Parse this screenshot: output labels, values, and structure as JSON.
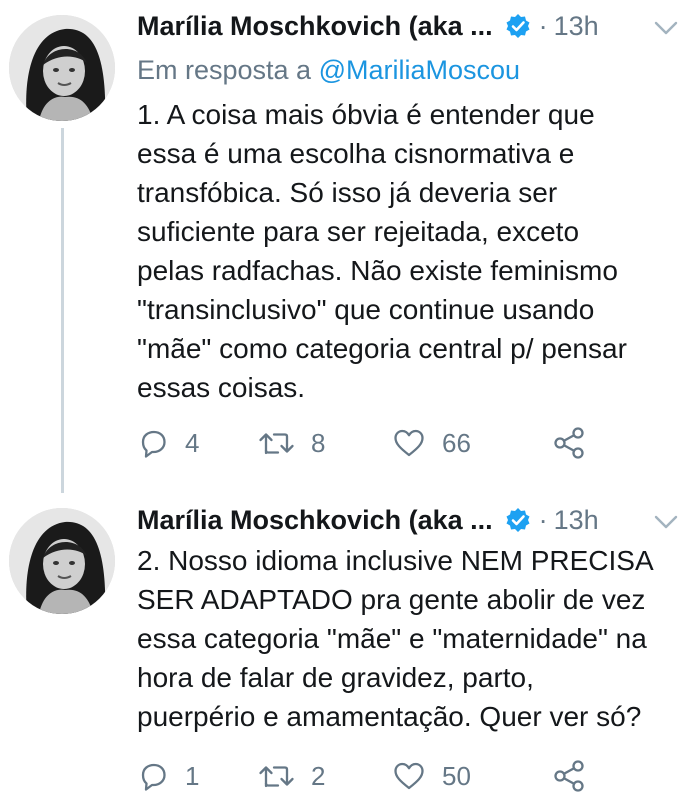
{
  "tweets": [
    {
      "author": "Marília Moschkovich (aka ...",
      "separator": "·",
      "time": "13h",
      "reply_prefix": "Em resposta a ",
      "reply_to": "@MariliaMoscou",
      "text": "1. A coisa mais óbvia é entender que\nessa é uma escolha cisnormativa e\ntransfóbica. Só isso já deveria ser\nsuficiente para ser rejeitada, exceto\npelas radfachas. Não existe feminismo\n\"transinclusivo\" que continue usando\n\"mãe\" como categoria central p/ pensar\nessas coisas.",
      "replies": "4",
      "retweets": "8",
      "likes": "66",
      "icons": {
        "verified": "verified-badge-icon",
        "caret": "chevron-down-icon",
        "reply": "reply-icon",
        "retweet": "retweet-icon",
        "like": "heart-icon",
        "share": "share-icon"
      }
    },
    {
      "author": "Marília Moschkovich (aka ...",
      "separator": "·",
      "time": "13h",
      "text": "2. Nosso idioma inclusive NEM PRECISA\nSER ADAPTADO pra gente abolir de vez\nessa categoria \"mãe\" e \"maternidade\" na\nhora de falar de gravidez, parto,\npuerpério e amamentação. Quer ver só?",
      "replies": "1",
      "retweets": "2",
      "likes": "50"
    }
  ],
  "colors": {
    "text": "#14171a",
    "secondary": "#657786",
    "link": "#1b95e0",
    "verified": "#1da1f2",
    "thread_line": "#ccd6dd"
  }
}
